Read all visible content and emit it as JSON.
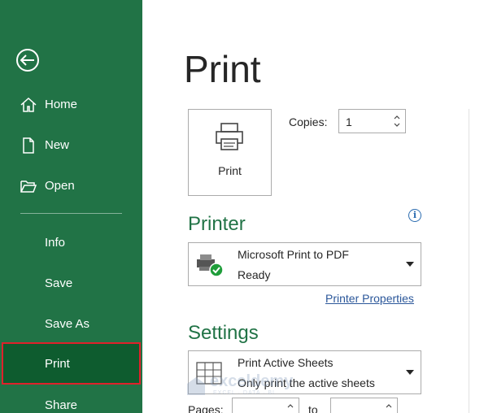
{
  "sidebar": {
    "items": [
      {
        "label": "Home",
        "icon": "home-icon"
      },
      {
        "label": "New",
        "icon": "new-document-icon"
      },
      {
        "label": "Open",
        "icon": "open-folder-icon"
      },
      {
        "label": "Info"
      },
      {
        "label": "Save"
      },
      {
        "label": "Save As"
      },
      {
        "label": "Print",
        "active": true
      },
      {
        "label": "Share"
      }
    ],
    "background": "#217346",
    "active_background": "#0e5c2f",
    "highlight_border": "#e0212b"
  },
  "main": {
    "title": "Print",
    "print_button_label": "Print",
    "copies": {
      "label": "Copies:",
      "value": "1"
    },
    "printer": {
      "heading": "Printer",
      "name": "Microsoft Print to PDF",
      "status": "Ready",
      "properties_link": "Printer Properties"
    },
    "settings": {
      "heading": "Settings",
      "option_title": "Print Active Sheets",
      "option_desc": "Only print the active sheets",
      "pages_label": "Pages:",
      "to_label": "to"
    },
    "accent_color": "#217346",
    "link_color": "#2b579a"
  },
  "watermark": {
    "brand": "exceldemy",
    "tagline": "EXCEL · DATA · BI"
  }
}
